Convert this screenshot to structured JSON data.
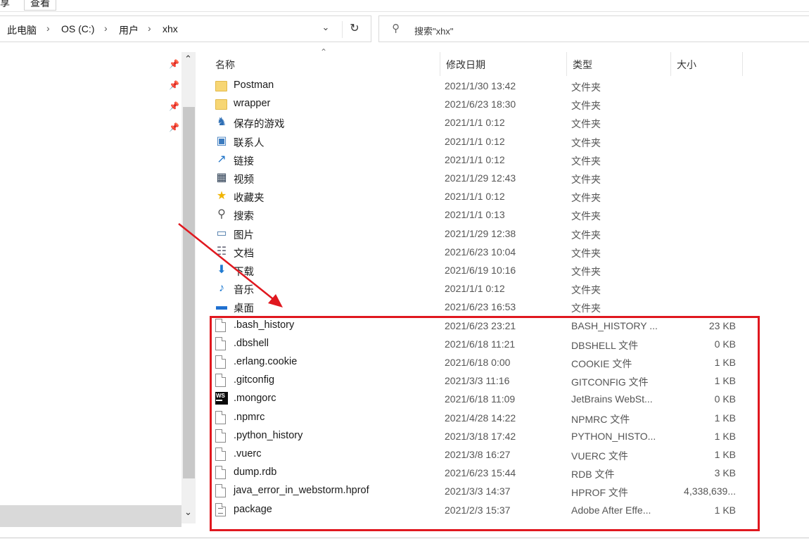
{
  "ribbon": {
    "tabs": [
      "享",
      "查看"
    ]
  },
  "address": {
    "crumbs": [
      "此电脑",
      "OS (C:)",
      "用户",
      "xhx"
    ],
    "dropdown_icon": "chevron-down-icon",
    "refresh_icon": "refresh-icon"
  },
  "search": {
    "placeholder": "搜索\"xhx\""
  },
  "columns": {
    "name": "名称",
    "date": "修改日期",
    "type": "类型",
    "size": "大小"
  },
  "files": [
    {
      "name": "Postman",
      "date": "2021/1/30 13:42",
      "type": "文件夹",
      "size": "",
      "icon": "folder-icon"
    },
    {
      "name": "wrapper",
      "date": "2021/6/23 18:30",
      "type": "文件夹",
      "size": "",
      "icon": "folder-icon"
    },
    {
      "name": "保存的游戏",
      "date": "2021/1/1 0:12",
      "type": "文件夹",
      "size": "",
      "icon": "saved-games-icon"
    },
    {
      "name": "联系人",
      "date": "2021/1/1 0:12",
      "type": "文件夹",
      "size": "",
      "icon": "contacts-icon"
    },
    {
      "name": "链接",
      "date": "2021/1/1 0:12",
      "type": "文件夹",
      "size": "",
      "icon": "links-icon"
    },
    {
      "name": "视频",
      "date": "2021/1/29 12:43",
      "type": "文件夹",
      "size": "",
      "icon": "videos-icon"
    },
    {
      "name": "收藏夹",
      "date": "2021/1/1 0:12",
      "type": "文件夹",
      "size": "",
      "icon": "favorites-icon"
    },
    {
      "name": "搜索",
      "date": "2021/1/1 0:13",
      "type": "文件夹",
      "size": "",
      "icon": "searches-icon"
    },
    {
      "name": "图片",
      "date": "2021/1/29 12:38",
      "type": "文件夹",
      "size": "",
      "icon": "pictures-icon"
    },
    {
      "name": "文档",
      "date": "2021/6/23 10:04",
      "type": "文件夹",
      "size": "",
      "icon": "documents-icon"
    },
    {
      "name": "下载",
      "date": "2021/6/19 10:16",
      "type": "文件夹",
      "size": "",
      "icon": "downloads-icon"
    },
    {
      "name": "音乐",
      "date": "2021/1/1 0:12",
      "type": "文件夹",
      "size": "",
      "icon": "music-icon"
    },
    {
      "name": "桌面",
      "date": "2021/6/23 16:53",
      "type": "文件夹",
      "size": "",
      "icon": "desktop-icon"
    },
    {
      "name": ".bash_history",
      "date": "2021/6/23 23:21",
      "type": "BASH_HISTORY ...",
      "size": "23 KB",
      "icon": "file-icon"
    },
    {
      "name": ".dbshell",
      "date": "2021/6/18 11:21",
      "type": "DBSHELL 文件",
      "size": "0 KB",
      "icon": "file-icon"
    },
    {
      "name": ".erlang.cookie",
      "date": "2021/6/18 0:00",
      "type": "COOKIE 文件",
      "size": "1 KB",
      "icon": "file-icon"
    },
    {
      "name": ".gitconfig",
      "date": "2021/3/3 11:16",
      "type": "GITCONFIG 文件",
      "size": "1 KB",
      "icon": "file-icon"
    },
    {
      "name": ".mongorc",
      "date": "2021/6/18 11:09",
      "type": "JetBrains WebSt...",
      "size": "0 KB",
      "icon": "webstorm-icon"
    },
    {
      "name": ".npmrc",
      "date": "2021/4/28 14:22",
      "type": "NPMRC 文件",
      "size": "1 KB",
      "icon": "file-icon"
    },
    {
      "name": ".python_history",
      "date": "2021/3/18 17:42",
      "type": "PYTHON_HISTO...",
      "size": "1 KB",
      "icon": "file-icon"
    },
    {
      "name": ".vuerc",
      "date": "2021/3/8 16:27",
      "type": "VUERC 文件",
      "size": "1 KB",
      "icon": "file-icon"
    },
    {
      "name": "dump.rdb",
      "date": "2021/6/23 15:44",
      "type": "RDB 文件",
      "size": "3 KB",
      "icon": "file-icon"
    },
    {
      "name": "java_error_in_webstorm.hprof",
      "date": "2021/3/3 14:37",
      "type": "HPROF 文件",
      "size": "4,338,639...",
      "icon": "file-icon"
    },
    {
      "name": "package",
      "date": "2021/2/3 15:37",
      "type": "Adobe After Effe...",
      "size": "1 KB",
      "icon": "text-file-icon"
    }
  ],
  "annotation": {
    "box_color": "#e0181f",
    "arrow_color": "#e0181f"
  }
}
